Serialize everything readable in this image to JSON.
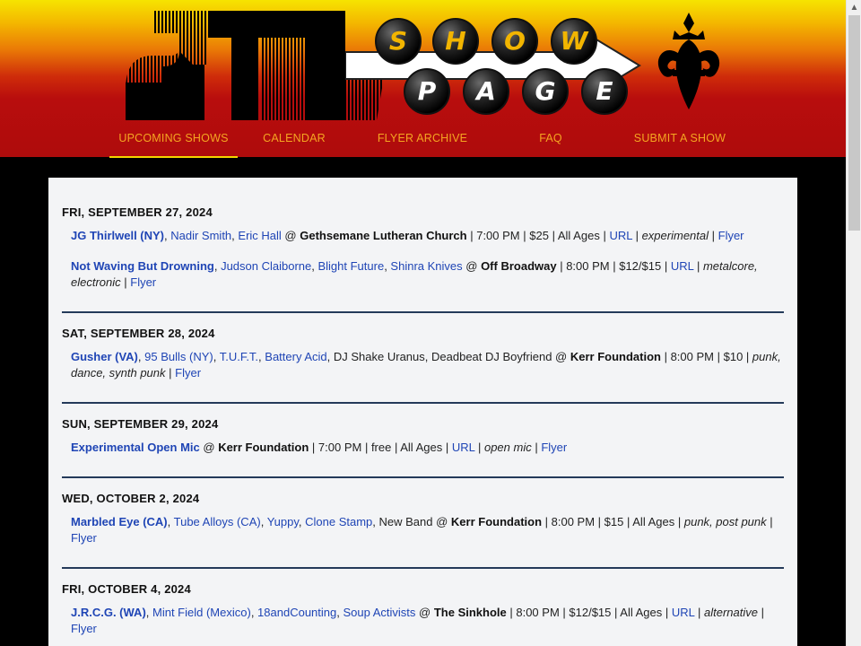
{
  "header": {
    "logo_letters_show": [
      "S",
      "H",
      "O",
      "W"
    ],
    "logo_letters_page": [
      "P",
      "A",
      "G",
      "E"
    ],
    "nav": [
      {
        "label": "UPCOMING SHOWS",
        "active": true
      },
      {
        "label": "CALENDAR",
        "active": false
      },
      {
        "label": "FLYER ARCHIVE",
        "active": false
      },
      {
        "label": "FAQ",
        "active": false
      },
      {
        "label": "SUBMIT A SHOW",
        "active": false
      }
    ]
  },
  "colors": {
    "nav_text": "#f4a521",
    "active_underline": "#f2d600",
    "link": "#1f45b5",
    "divider": "#243a5a",
    "content_bg": "#f3f4f6"
  },
  "days": [
    {
      "date": "FRI, SEPTEMBER 27, 2024",
      "shows": [
        {
          "headliner": "JG Thirlwell (NY)",
          "others": [
            "Nadir Smith",
            "Eric Hall"
          ],
          "plain_others": [],
          "venue": "Gethsemane Lutheran Church",
          "time": "7:00 PM",
          "price": "$25",
          "ages": "All Ages",
          "url": "URL",
          "genre": "experimental",
          "flyer": "Flyer"
        },
        {
          "headliner": "Not Waving But Drowning",
          "others": [
            "Judson Claiborne",
            "Blight Future",
            "Shinra Knives"
          ],
          "plain_others": [],
          "venue": "Off Broadway",
          "time": "8:00 PM",
          "price": "$12/$15",
          "ages": "",
          "url": "URL",
          "genre": "metalcore, electronic",
          "flyer": "Flyer"
        }
      ]
    },
    {
      "date": "SAT, SEPTEMBER 28, 2024",
      "shows": [
        {
          "headliner": "Gusher (VA)",
          "others": [
            "95 Bulls (NY)",
            "T.U.F.T.",
            "Battery Acid"
          ],
          "plain_others": [
            "DJ Shake Uranus",
            "Deadbeat DJ Boyfriend"
          ],
          "venue": "Kerr Foundation",
          "time": "8:00 PM",
          "price": "$10",
          "ages": "",
          "url": "",
          "genre": "punk, dance, synth punk",
          "flyer": "Flyer"
        }
      ]
    },
    {
      "date": "SUN, SEPTEMBER 29, 2024",
      "shows": [
        {
          "headliner": "Experimental Open Mic",
          "others": [],
          "plain_others": [],
          "venue": "Kerr Foundation",
          "time": "7:00 PM",
          "price": "free",
          "ages": "All Ages",
          "url": "URL",
          "genre": "open mic",
          "flyer": "Flyer"
        }
      ]
    },
    {
      "date": "WED, OCTOBER 2, 2024",
      "shows": [
        {
          "headliner": "Marbled Eye (CA)",
          "others": [
            "Tube Alloys (CA)",
            "Yuppy",
            "Clone Stamp"
          ],
          "plain_others": [
            "New Band"
          ],
          "venue": "Kerr Foundation",
          "time": "8:00 PM",
          "price": "$15",
          "ages": "All Ages",
          "url": "",
          "genre": "punk, post punk",
          "flyer": "Flyer"
        }
      ]
    },
    {
      "date": "FRI, OCTOBER 4, 2024",
      "shows": [
        {
          "headliner": "J.R.C.G. (WA)",
          "others": [
            "Mint Field (Mexico)",
            "18andCounting",
            "Soup Activists"
          ],
          "plain_others": [],
          "venue": "The Sinkhole",
          "time": "8:00 PM",
          "price": "$12/$15",
          "ages": "All Ages",
          "url": "URL",
          "genre": "alternative",
          "flyer": "Flyer"
        }
      ]
    }
  ]
}
